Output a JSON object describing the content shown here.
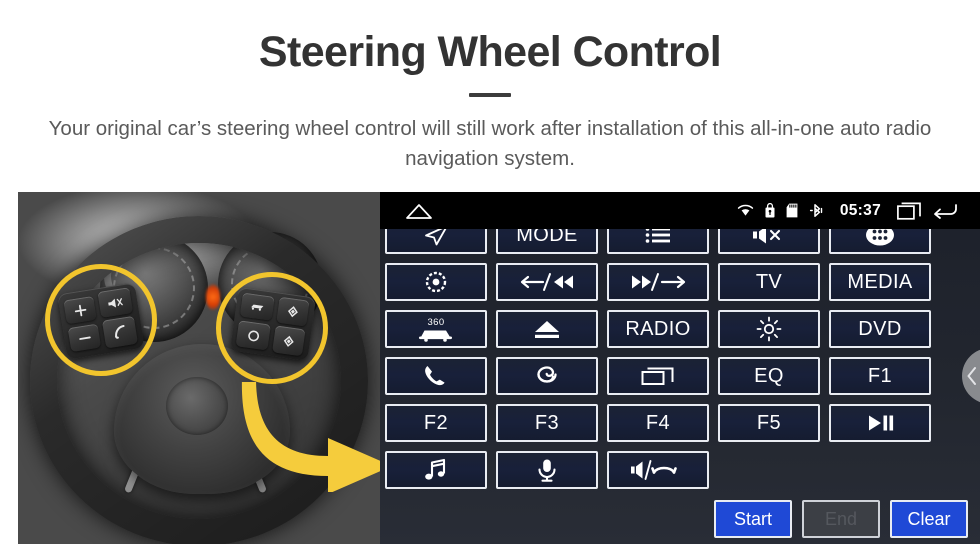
{
  "header": {
    "title": "Steering Wheel Control",
    "subtitle": "Your original car’s steering wheel control will still work after installation of this all-in-one auto radio navigation system."
  },
  "colors": {
    "accent_yellow": "#f2c52d",
    "button_blue": "#1f49d6",
    "panel_bg": "#22262f",
    "button_fill": "#18203a",
    "button_border": "#e9ecf2",
    "statusbar_bg": "#000000",
    "title_text": "#333333",
    "subtitle_text": "#5a5a5a"
  },
  "photo": {
    "alt": "steering-wheel-photo",
    "left_cluster": {
      "name": "left-steering-wheel-button-cluster",
      "keys": [
        "+",
        "-",
        "mute-icon",
        "phone-answer-icon"
      ]
    },
    "right_cluster": {
      "name": "right-steering-wheel-button-cluster",
      "keys": [
        "source-icon",
        "mode-circle-icon",
        "seek-up-icon",
        "seek-down-icon"
      ]
    },
    "highlights": [
      "left-cluster-highlight-ring",
      "right-cluster-highlight-ring"
    ],
    "arrow": "yellow-pointer-arrow"
  },
  "headunit": {
    "statusbar": {
      "home_icon": "home-icon",
      "clock": "05:37",
      "icons": [
        "wifi-icon",
        "usb-lock-icon",
        "sdcard-icon",
        "bluetooth-icon"
      ],
      "recents_icon": "recents-icon",
      "back_icon": "back-icon"
    },
    "grid": {
      "rows": [
        [
          {
            "name": "navigation-button",
            "icon": "navigation-arrow-icon",
            "label": ""
          },
          {
            "name": "mode-button",
            "icon": "",
            "label": "MODE"
          },
          {
            "name": "menu-list-button",
            "icon": "list-icon",
            "label": ""
          },
          {
            "name": "mute-button",
            "icon": "mute-icon",
            "label": ""
          },
          {
            "name": "apps-button",
            "icon": "apps-grid-icon",
            "label": ""
          }
        ],
        [
          {
            "name": "power-button",
            "icon": "power-disc-icon",
            "label": ""
          },
          {
            "name": "previous-button",
            "icon": "previous-track-icon",
            "label": ""
          },
          {
            "name": "next-button",
            "icon": "next-track-icon",
            "label": ""
          },
          {
            "name": "tv-button",
            "icon": "",
            "label": "TV"
          },
          {
            "name": "media-button",
            "icon": "",
            "label": "MEDIA"
          }
        ],
        [
          {
            "name": "camera-360-button",
            "icon": "car-360-icon",
            "label": ""
          },
          {
            "name": "eject-button",
            "icon": "eject-icon",
            "label": ""
          },
          {
            "name": "radio-button",
            "icon": "",
            "label": "RADIO"
          },
          {
            "name": "brightness-button",
            "icon": "brightness-icon",
            "label": ""
          },
          {
            "name": "dvd-button",
            "icon": "",
            "label": "DVD"
          }
        ],
        [
          {
            "name": "phone-button",
            "icon": "phone-icon",
            "label": ""
          },
          {
            "name": "voice-assist-button",
            "icon": "spiral-icon",
            "label": ""
          },
          {
            "name": "task-button",
            "icon": "recents-window-icon",
            "label": ""
          },
          {
            "name": "eq-button",
            "icon": "",
            "label": "EQ"
          },
          {
            "name": "f1-button",
            "icon": "",
            "label": "F1"
          }
        ],
        [
          {
            "name": "f2-button",
            "icon": "",
            "label": "F2"
          },
          {
            "name": "f3-button",
            "icon": "",
            "label": "F3"
          },
          {
            "name": "f4-button",
            "icon": "",
            "label": "F4"
          },
          {
            "name": "f5-button",
            "icon": "",
            "label": "F5"
          },
          {
            "name": "play-pause-button",
            "icon": "play-pause-icon",
            "label": ""
          }
        ],
        [
          {
            "name": "music-button",
            "icon": "music-note-icon",
            "label": ""
          },
          {
            "name": "microphone-button",
            "icon": "microphone-icon",
            "label": ""
          },
          {
            "name": "volume-hangup-button",
            "icon": "volume-hangup-icon",
            "label": ""
          }
        ]
      ]
    },
    "actions": [
      {
        "name": "start-button",
        "label": "Start",
        "state": "enabled"
      },
      {
        "name": "end-button",
        "label": "End",
        "state": "disabled"
      },
      {
        "name": "clear-button",
        "label": "Clear",
        "state": "enabled"
      }
    ],
    "drawer_handle": "drawer-chevron-icon"
  }
}
